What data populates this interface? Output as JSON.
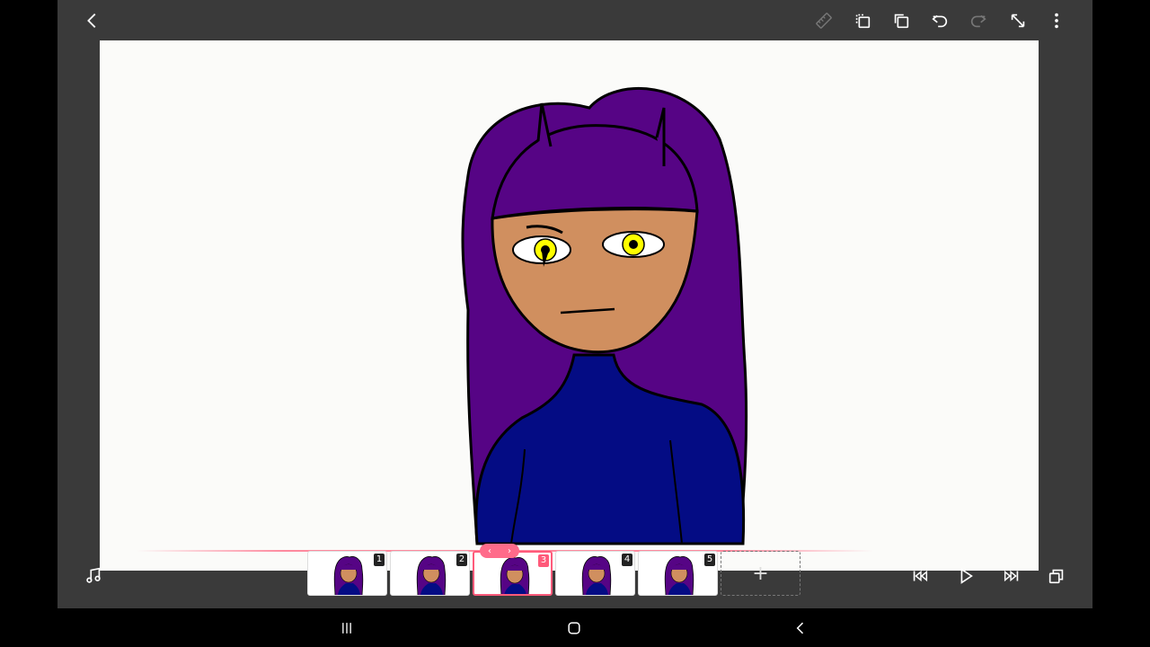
{
  "topbar": {
    "icons": [
      "back-arrow-icon",
      "ruler-icon",
      "copy-frame-icon",
      "duplicate-icon",
      "undo-icon",
      "redo-icon",
      "expand-icon",
      "more-vertical-icon"
    ]
  },
  "timeline": {
    "frames": [
      {
        "number": "1"
      },
      {
        "number": "2"
      },
      {
        "number": "3"
      },
      {
        "number": "4"
      },
      {
        "number": "5"
      }
    ],
    "active_frame": "3",
    "add_label": "+"
  },
  "colors": {
    "hair": "#560485",
    "skin": "#d08f5f",
    "shirt": "#040c84",
    "eye": "#ffff00",
    "accent": "#ff5a7a"
  }
}
